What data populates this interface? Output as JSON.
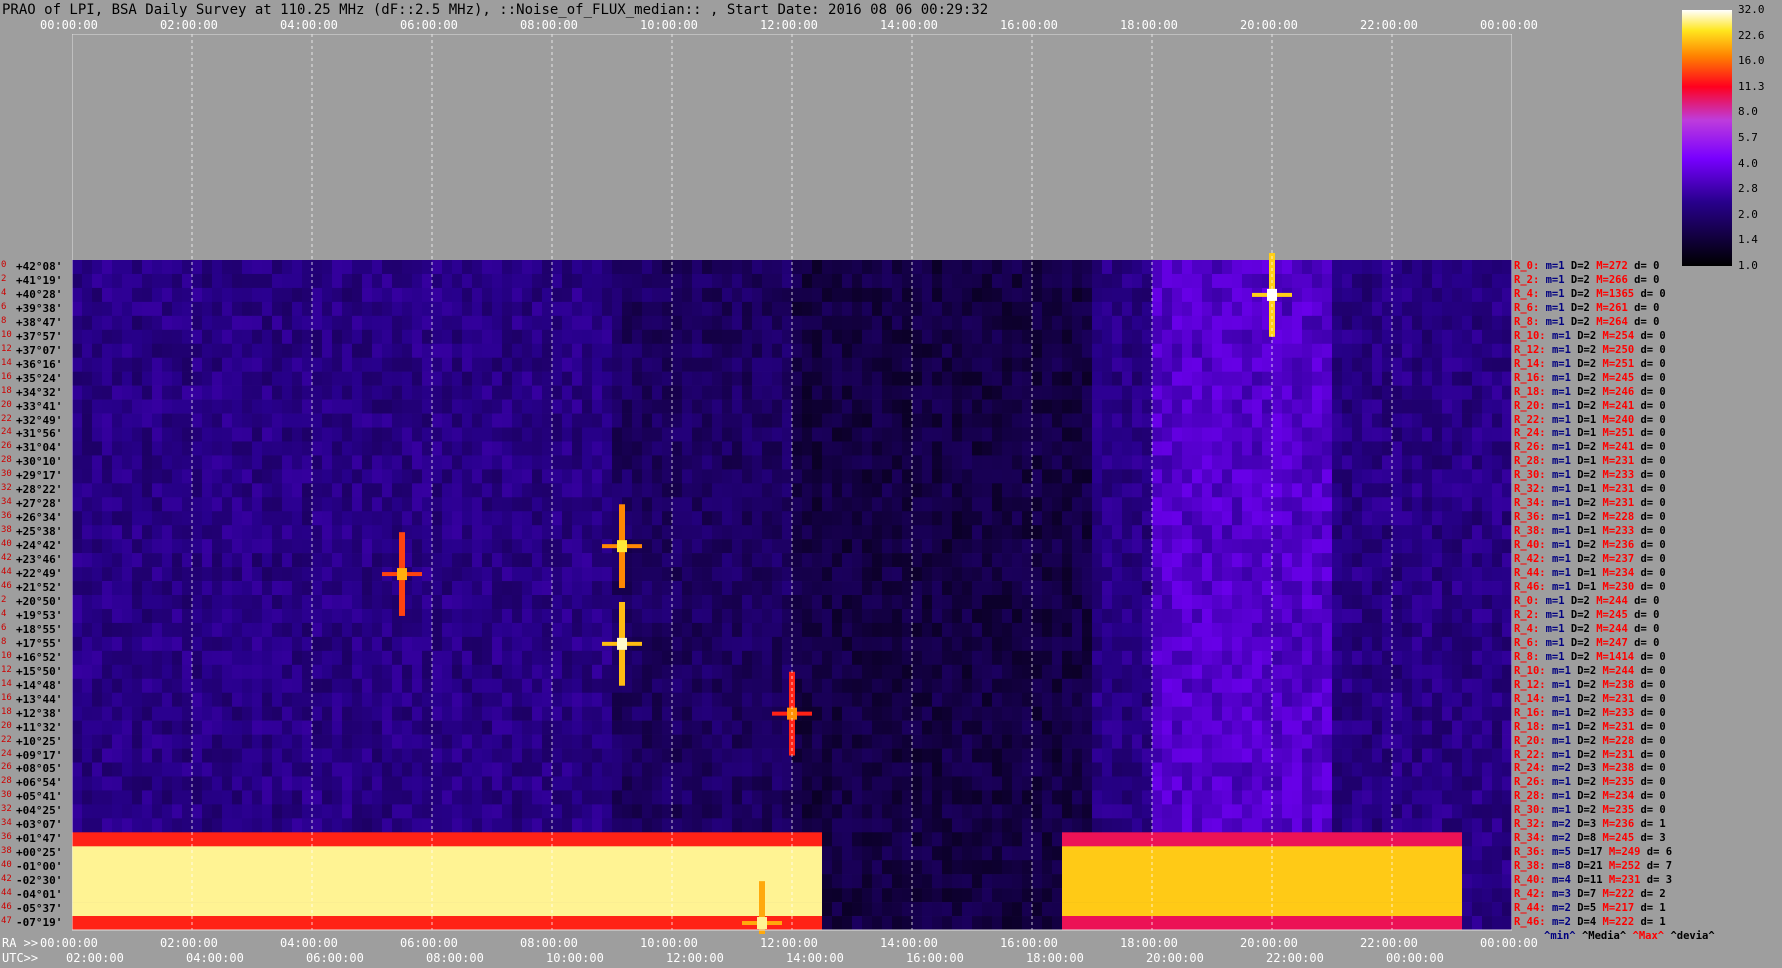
{
  "title": "PRAO of LPI, BSA Daily Survey at 110.25 MHz (dF::2.5 MHz), ::Noise_of_FLUX_median:: , Start Date: 2016 08 06 00:29:32",
  "chart_data": {
    "type": "heatmap",
    "title": "PRAO of LPI, BSA Daily Survey at 110.25 MHz (dF::2.5 MHz), ::Noise_of_FLUX_median:: , Start Date: 2016 08 06 00:29:32",
    "x_ticks_top": [
      "00:00:00",
      "02:00:00",
      "04:00:00",
      "06:00:00",
      "08:00:00",
      "10:00:00",
      "12:00:00",
      "14:00:00",
      "16:00:00",
      "18:00:00",
      "20:00:00",
      "22:00:00",
      "00:00:00"
    ],
    "ra_axis": {
      "label": "RA >>",
      "ticks": [
        "00:00:00",
        "02:00:00",
        "04:00:00",
        "06:00:00",
        "08:00:00",
        "10:00:00",
        "12:00:00",
        "14:00:00",
        "16:00:00",
        "18:00:00",
        "20:00:00",
        "22:00:00",
        "00:00:00"
      ]
    },
    "utc_axis": {
      "label": "UTC>>",
      "ticks": [
        "02:00:00",
        "04:00:00",
        "06:00:00",
        "08:00:00",
        "10:00:00",
        "12:00:00",
        "14:00:00",
        "16:00:00",
        "18:00:00",
        "20:00:00",
        "22:00:00",
        "00:00:00"
      ]
    },
    "y_ticks": [
      "+42°08'",
      "+41°19'",
      "+40°28'",
      "+39°38'",
      "+38°47'",
      "+37°57'",
      "+37°07'",
      "+36°16'",
      "+35°24'",
      "+34°32'",
      "+33°41'",
      "+32°49'",
      "+31°56'",
      "+31°04'",
      "+30°10'",
      "+29°17'",
      "+28°22'",
      "+27°28'",
      "+26°34'",
      "+25°38'",
      "+24°42'",
      "+23°46'",
      "+22°49'",
      "+21°52'",
      "+20°50'",
      "+19°53'",
      "+18°55'",
      "+17°55'",
      "+16°52'",
      "+15°50'",
      "+14°48'",
      "+13°44'",
      "+12°38'",
      "+11°32'",
      "+10°25'",
      "+09°17'",
      "+08°05'",
      "+06°54'",
      "+05°41'",
      "+04°25'",
      "+03°07'",
      "+01°47'",
      "+00°25'",
      "-01°00'",
      "-02°30'",
      "-04°01'",
      "-05°37'",
      "-07°19'"
    ],
    "row_numbers": [
      "0",
      "2",
      "4",
      "6",
      "8",
      "10",
      "12",
      "14",
      "16",
      "18",
      "20",
      "22",
      "24",
      "26",
      "28",
      "30",
      "32",
      "34",
      "36",
      "38",
      "40",
      "42",
      "44",
      "46",
      "2",
      "4",
      "6",
      "8",
      "10",
      "12",
      "14",
      "16",
      "18",
      "20",
      "22",
      "24",
      "26",
      "28",
      "30",
      "32",
      "34",
      "36",
      "38",
      "40",
      "42",
      "44",
      "46",
      "47"
    ],
    "colorbar": {
      "ticks": [
        "32.0",
        "22.6",
        "16.0",
        "11.3",
        "8.0",
        "5.7",
        "4.0",
        "2.8",
        "2.0",
        "1.4",
        "1.0"
      ],
      "scale": "log",
      "range": [
        1.0,
        32.0
      ],
      "colormap": "gnuplot2"
    },
    "grid": true,
    "empty_band_color": "#9e9e9e",
    "bright_bands": [
      {
        "dec_from": "+01°47'",
        "dec_to": "-07°19'",
        "ra_from": "00:00:00",
        "ra_to": "12:30:00",
        "level": 28
      },
      {
        "dec_from": "+01°47'",
        "dec_to": "-07°19'",
        "ra_from": "16:30:00",
        "ra_to": "23:10:00",
        "level": 22
      }
    ],
    "sources": [
      {
        "ra": "20:00:00",
        "dec": "+40°28'",
        "level": 32
      },
      {
        "ra": "09:10:00",
        "dec": "+17°55'",
        "level": 30
      },
      {
        "ra": "09:10:00",
        "dec": "+24°42'",
        "level": 25
      },
      {
        "ra": "05:30:00",
        "dec": "+22°49'",
        "level": 20
      },
      {
        "ra": "12:00:00",
        "dec": "+12°38'",
        "level": 18
      },
      {
        "ra": "11:30:00",
        "dec": "-07°19'",
        "level": 28
      }
    ],
    "legend_rows": [
      {
        "label": "R_0:",
        "m": "m=1",
        "d": "D=2",
        "M": "M=272",
        "dev": "d= 0"
      },
      {
        "label": "R_2:",
        "m": "m=1",
        "d": "D=2",
        "M": "M=266",
        "dev": "d= 0"
      },
      {
        "label": "R_4:",
        "m": "m=1",
        "d": "D=2",
        "M": "M=1365",
        "dev": "d= 0"
      },
      {
        "label": "R_6:",
        "m": "m=1",
        "d": "D=2",
        "M": "M=261",
        "dev": "d= 0"
      },
      {
        "label": "R_8:",
        "m": "m=1",
        "d": "D=2",
        "M": "M=264",
        "dev": "d= 0"
      },
      {
        "label": "R_10:",
        "m": "m=1",
        "d": "D=2",
        "M": "M=254",
        "dev": "d= 0"
      },
      {
        "label": "R_12:",
        "m": "m=1",
        "d": "D=2",
        "M": "M=250",
        "dev": "d= 0"
      },
      {
        "label": "R_14:",
        "m": "m=1",
        "d": "D=2",
        "M": "M=251",
        "dev": "d= 0"
      },
      {
        "label": "R_16:",
        "m": "m=1",
        "d": "D=2",
        "M": "M=245",
        "dev": "d= 0"
      },
      {
        "label": "R_18:",
        "m": "m=1",
        "d": "D=2",
        "M": "M=246",
        "dev": "d= 0"
      },
      {
        "label": "R_20:",
        "m": "m=1",
        "d": "D=2",
        "M": "M=241",
        "dev": "d= 0"
      },
      {
        "label": "R_22:",
        "m": "m=1",
        "d": "D=1",
        "M": "M=240",
        "dev": "d= 0"
      },
      {
        "label": "R_24:",
        "m": "m=1",
        "d": "D=1",
        "M": "M=251",
        "dev": "d= 0"
      },
      {
        "label": "R_26:",
        "m": "m=1",
        "d": "D=2",
        "M": "M=241",
        "dev": "d= 0"
      },
      {
        "label": "R_28:",
        "m": "m=1",
        "d": "D=1",
        "M": "M=231",
        "dev": "d= 0"
      },
      {
        "label": "R_30:",
        "m": "m=1",
        "d": "D=2",
        "M": "M=233",
        "dev": "d= 0"
      },
      {
        "label": "R_32:",
        "m": "m=1",
        "d": "D=1",
        "M": "M=231",
        "dev": "d= 0"
      },
      {
        "label": "R_34:",
        "m": "m=1",
        "d": "D=2",
        "M": "M=231",
        "dev": "d= 0"
      },
      {
        "label": "R_36:",
        "m": "m=1",
        "d": "D=2",
        "M": "M=228",
        "dev": "d= 0"
      },
      {
        "label": "R_38:",
        "m": "m=1",
        "d": "D=1",
        "M": "M=233",
        "dev": "d= 0"
      },
      {
        "label": "R_40:",
        "m": "m=1",
        "d": "D=2",
        "M": "M=236",
        "dev": "d= 0"
      },
      {
        "label": "R_42:",
        "m": "m=1",
        "d": "D=2",
        "M": "M=237",
        "dev": "d= 0"
      },
      {
        "label": "R_44:",
        "m": "m=1",
        "d": "D=1",
        "M": "M=234",
        "dev": "d= 0"
      },
      {
        "label": "R_46:",
        "m": "m=1",
        "d": "D=1",
        "M": "M=230",
        "dev": "d= 0"
      },
      {
        "label": "R_0:",
        "m": "m=1",
        "d": "D=2",
        "M": "M=244",
        "dev": "d= 0"
      },
      {
        "label": "R_2:",
        "m": "m=1",
        "d": "D=2",
        "M": "M=245",
        "dev": "d= 0"
      },
      {
        "label": "R_4:",
        "m": "m=1",
        "d": "D=2",
        "M": "M=244",
        "dev": "d= 0"
      },
      {
        "label": "R_6:",
        "m": "m=1",
        "d": "D=2",
        "M": "M=247",
        "dev": "d= 0"
      },
      {
        "label": "R_8:",
        "m": "m=1",
        "d": "D=2",
        "M": "M=1414",
        "dev": "d= 0"
      },
      {
        "label": "R_10:",
        "m": "m=1",
        "d": "D=2",
        "M": "M=244",
        "dev": "d= 0"
      },
      {
        "label": "R_12:",
        "m": "m=1",
        "d": "D=2",
        "M": "M=238",
        "dev": "d= 0"
      },
      {
        "label": "R_14:",
        "m": "m=1",
        "d": "D=2",
        "M": "M=231",
        "dev": "d= 0"
      },
      {
        "label": "R_16:",
        "m": "m=1",
        "d": "D=2",
        "M": "M=233",
        "dev": "d= 0"
      },
      {
        "label": "R_18:",
        "m": "m=1",
        "d": "D=2",
        "M": "M=231",
        "dev": "d= 0"
      },
      {
        "label": "R_20:",
        "m": "m=1",
        "d": "D=2",
        "M": "M=228",
        "dev": "d= 0"
      },
      {
        "label": "R_22:",
        "m": "m=1",
        "d": "D=2",
        "M": "M=231",
        "dev": "d= 0"
      },
      {
        "label": "R_24:",
        "m": "m=2",
        "d": "D=3",
        "M": "M=238",
        "dev": "d= 0"
      },
      {
        "label": "R_26:",
        "m": "m=1",
        "d": "D=2",
        "M": "M=235",
        "dev": "d= 0"
      },
      {
        "label": "R_28:",
        "m": "m=1",
        "d": "D=2",
        "M": "M=234",
        "dev": "d= 0"
      },
      {
        "label": "R_30:",
        "m": "m=1",
        "d": "D=2",
        "M": "M=235",
        "dev": "d= 0"
      },
      {
        "label": "R_32:",
        "m": "m=2",
        "d": "D=3",
        "M": "M=236",
        "dev": "d= 1"
      },
      {
        "label": "R_34:",
        "m": "m=2",
        "d": "D=8",
        "M": "M=245",
        "dev": "d= 3"
      },
      {
        "label": "R_36:",
        "m": "m=5",
        "d": "D=17",
        "M": "M=249",
        "dev": "d= 6"
      },
      {
        "label": "R_38:",
        "m": "m=8",
        "d": "D=21",
        "M": "M=252",
        "dev": "d= 7"
      },
      {
        "label": "R_40:",
        "m": "m=4",
        "d": "D=11",
        "M": "M=231",
        "dev": "d= 3"
      },
      {
        "label": "R_42:",
        "m": "m=3",
        "d": "D=7",
        "M": "M=222",
        "dev": "d= 2"
      },
      {
        "label": "R_44:",
        "m": "m=2",
        "d": "D=5",
        "M": "M=217",
        "dev": "d= 1"
      },
      {
        "label": "R_46:",
        "m": "m=2",
        "d": "D=4",
        "M": "M=222",
        "dev": "d= 1"
      }
    ],
    "legend_footer": [
      "^min^",
      "^Media^",
      "^Max^",
      "^devia^"
    ]
  },
  "colors": {
    "min": "#000080",
    "media": "#000000",
    "max": "#ff0000",
    "row_number": "#cc0000",
    "background": "#9e9e9e"
  }
}
